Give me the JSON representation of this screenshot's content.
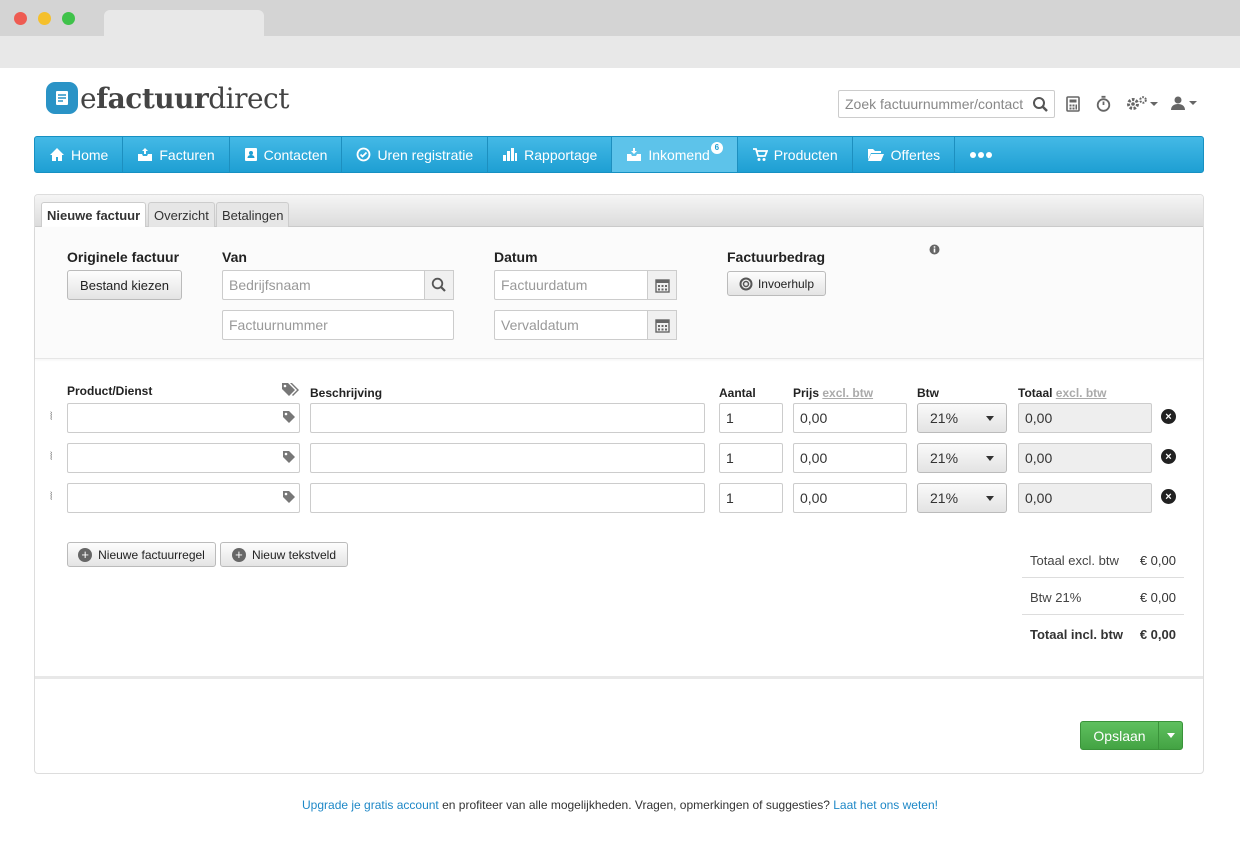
{
  "app": {
    "logo_prefix": "e",
    "logo_bold": "factuur",
    "logo_suffix": "direct"
  },
  "header": {
    "search_placeholder": "Zoek factuurnummer/contact"
  },
  "nav": [
    {
      "label": "Home"
    },
    {
      "label": "Facturen"
    },
    {
      "label": "Contacten"
    },
    {
      "label": "Uren registratie"
    },
    {
      "label": "Rapportage"
    },
    {
      "label": "Inkomend",
      "badge": "6"
    },
    {
      "label": "Producten"
    },
    {
      "label": "Offertes"
    }
  ],
  "tabs": [
    {
      "label": "Nieuwe factuur"
    },
    {
      "label": "Overzicht"
    },
    {
      "label": "Betalingen"
    }
  ],
  "form": {
    "originele_label": "Originele factuur",
    "bestand_button": "Bestand kiezen",
    "van_label": "Van",
    "bedrijfsnaam_placeholder": "Bedrijfsnaam",
    "factuurnummer_placeholder": "Factuurnummer",
    "datum_label": "Datum",
    "factuurdatum_placeholder": "Factuurdatum",
    "vervaldatum_placeholder": "Vervaldatum",
    "factuurbedrag_label": "Factuurbedrag",
    "invoerhulp_button": "Invoerhulp"
  },
  "lines": {
    "headers": {
      "product": "Product/Dienst",
      "beschrijving": "Beschrijving",
      "aantal": "Aantal",
      "prijs": "Prijs",
      "prijs_note": "excl. btw",
      "btw": "Btw",
      "totaal": "Totaal",
      "totaal_note": "excl. btw"
    },
    "rows": [
      {
        "aantal": "1",
        "prijs": "0,00",
        "btw": "21%",
        "totaal": "0,00"
      },
      {
        "aantal": "1",
        "prijs": "0,00",
        "btw": "21%",
        "totaal": "0,00"
      },
      {
        "aantal": "1",
        "prijs": "0,00",
        "btw": "21%",
        "totaal": "0,00"
      }
    ]
  },
  "actions": {
    "new_line": "Nieuwe factuurregel",
    "new_text": "Nieuw tekstveld"
  },
  "summary": [
    {
      "label": "Totaal excl. btw",
      "value": "€ 0,00"
    },
    {
      "label": "Btw 21%",
      "value": "€ 0,00"
    },
    {
      "label": "Totaal incl. btw",
      "value": "€ 0,00"
    }
  ],
  "save": {
    "label": "Opslaan"
  },
  "footer": {
    "link1": "Upgrade je gratis account",
    "text1": " en profiteer van alle mogelijkheden. Vragen, opmerkingen of suggesties? ",
    "link2": "Laat het ons weten!"
  },
  "colors": {
    "nav": "#1e9fd3",
    "save": "#4cae4c",
    "link": "#1e88c7"
  }
}
